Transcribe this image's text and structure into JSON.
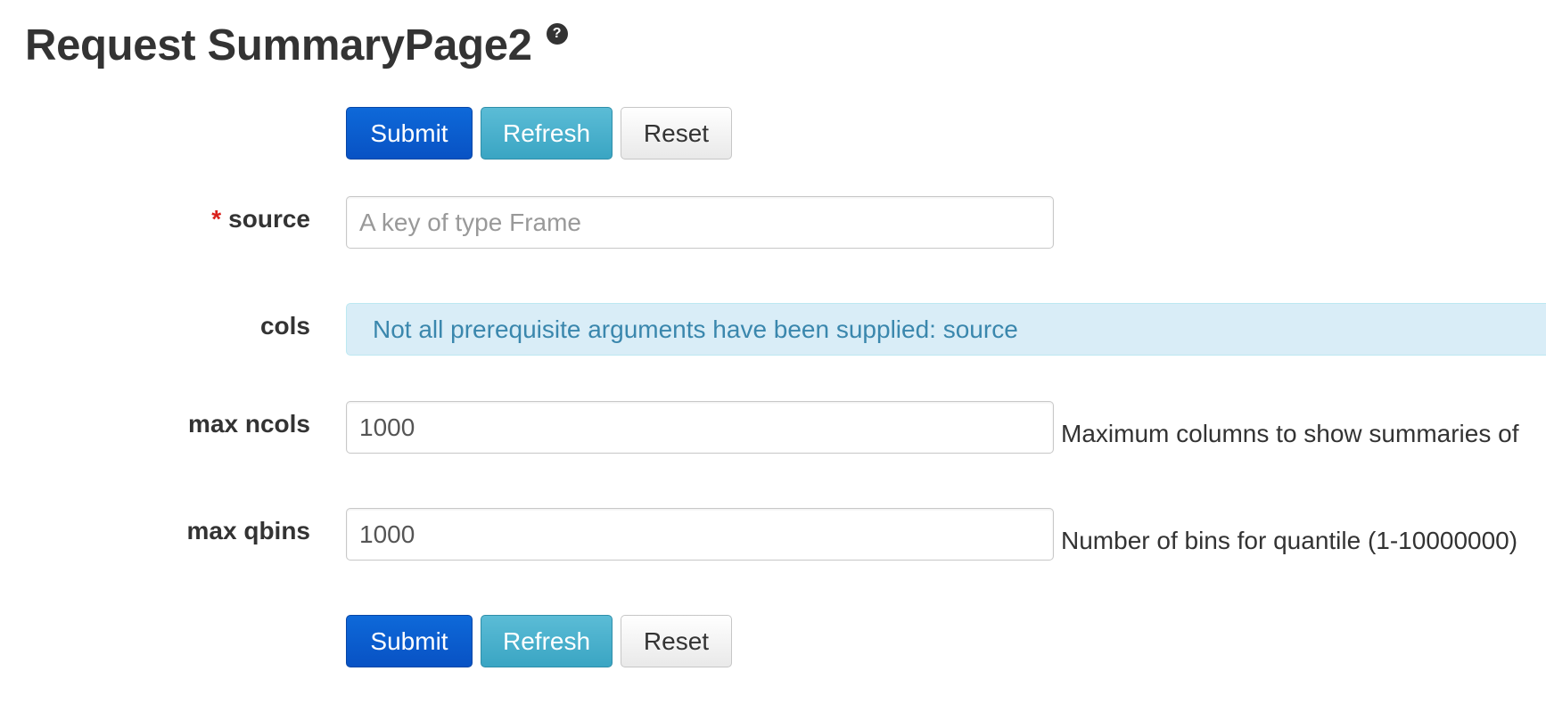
{
  "page": {
    "title": "Request SummaryPage2",
    "help_icon": "question-circle-icon"
  },
  "buttons": {
    "submit_label": "Submit",
    "refresh_label": "Refresh",
    "reset_label": "Reset"
  },
  "form": {
    "source": {
      "label": "source",
      "required_marker": "*",
      "value": "",
      "placeholder": "A key of type Frame"
    },
    "cols": {
      "label": "cols",
      "message": "Not all prerequisite arguments have been supplied: source"
    },
    "max_ncols": {
      "label": "max ncols",
      "value": "1000",
      "help": "Maximum columns to show summaries of"
    },
    "max_qbins": {
      "label": "max qbins",
      "value": "1000",
      "help": "Number of bins for quantile (1-10000000)"
    }
  },
  "colors": {
    "primary": "#0852c4",
    "info": "#3aa5c3",
    "alert_bg": "#d9edf7",
    "alert_text": "#3a87ad",
    "required": "#d9211c"
  }
}
